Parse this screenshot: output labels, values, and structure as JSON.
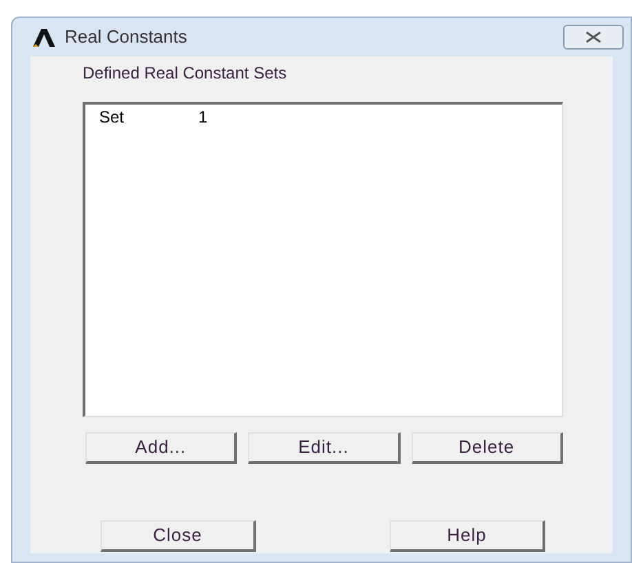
{
  "window": {
    "title": "Real Constants"
  },
  "heading": "Defined Real Constant Sets",
  "sets": [
    {
      "label": "Set",
      "number": "1",
      "selected": false
    }
  ],
  "action_buttons": [
    "Add...",
    "Edit...",
    "Delete"
  ],
  "footer_buttons": [
    "Close",
    "Help"
  ]
}
